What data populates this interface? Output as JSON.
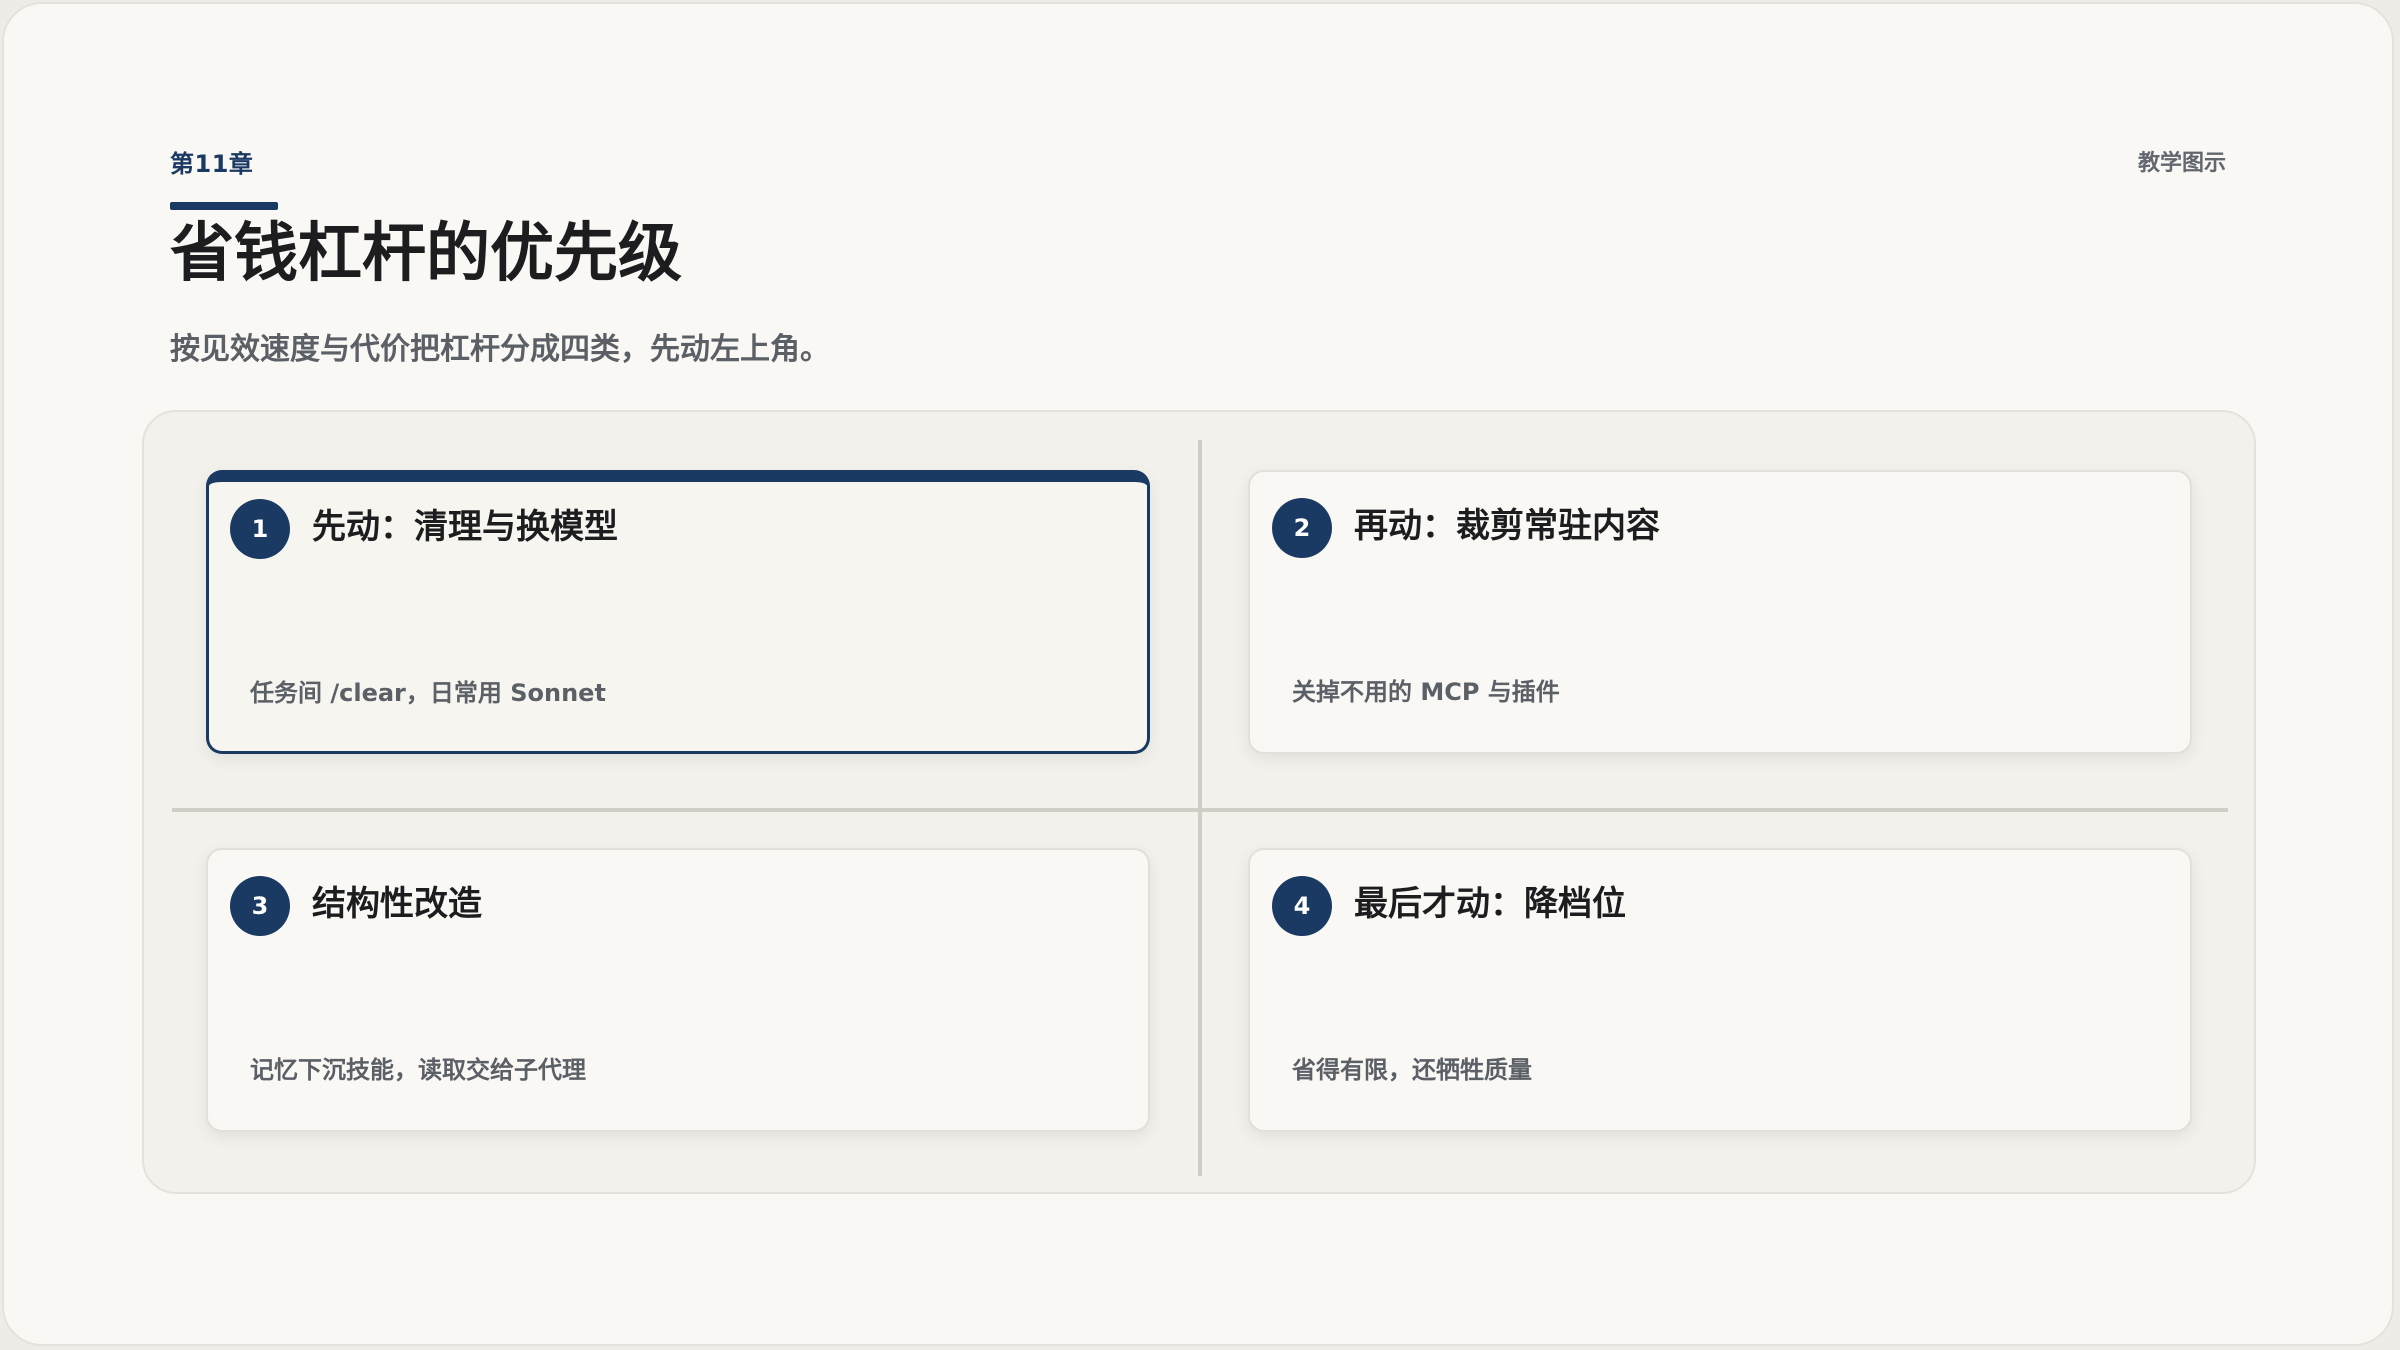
{
  "header": {
    "chapter": "第11章",
    "title": "省钱杠杆的优先级",
    "subtitle": "按见效速度与代价把杠杆分成四类，先动左上角。",
    "tag": "教学图示"
  },
  "quadrants": [
    {
      "number": "1",
      "title": "先动：清理与换模型",
      "desc": "任务间 /clear，日常用 Sonnet",
      "highlighted": true
    },
    {
      "number": "2",
      "title": "再动：裁剪常驻内容",
      "desc": "关掉不用的 MCP 与插件",
      "highlighted": false
    },
    {
      "number": "3",
      "title": "结构性改造",
      "desc": "记忆下沉技能，读取交给子代理",
      "highlighted": false
    },
    {
      "number": "4",
      "title": "最后才动：降档位",
      "desc": "省得有限，还牺牲质量",
      "highlighted": false
    }
  ],
  "colors": {
    "accent": "#1b3a63",
    "background": "#f9f8f4",
    "panel": "#f2f1ec",
    "muted_text": "#5b5f66"
  }
}
